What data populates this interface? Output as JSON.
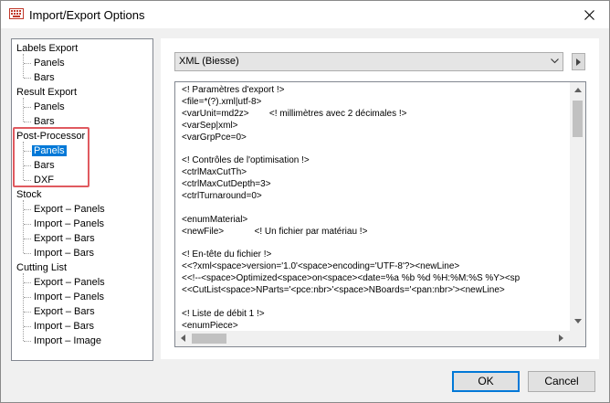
{
  "window": {
    "title": "Import/Export Options"
  },
  "tree": {
    "items": [
      "Labels Export",
      "Panels",
      "Bars",
      "Result Export",
      "Panels",
      "Bars",
      "Post-Processor",
      "Panels",
      "Bars",
      "DXF",
      "Stock",
      "Export – Panels",
      "Import – Panels",
      "Export – Bars",
      "Import – Bars",
      "Cutting List",
      "Export – Panels",
      "Import – Panels",
      "Export – Bars",
      "Import – Bars",
      "Import – Image"
    ],
    "selected": "Post-Processor / Panels"
  },
  "format": {
    "selected": "XML (Biesse)"
  },
  "editor": {
    "lines": [
      "<! Paramètres d'export !>",
      "<file=*(?).xml|utf-8>",
      "<varUnit=md2z>        <! millimètres avec 2 décimales !>",
      "<varSep|xml>",
      "<varGrpPce=0>",
      "",
      "<! Contrôles de l'optimisation !>",
      "<ctrlMaxCutTh>",
      "<ctrlMaxCutDepth=3>",
      "<ctrlTurnaround=0>",
      "",
      "<enumMaterial>",
      "<newFile>            <! Un fichier par matériau !>",
      "",
      "<! En-tête du fichier !>",
      "<<?xml<space>version='1.0'<space>encoding='UTF-8'?><newLine>",
      "<<!--<space>Optimized<space>on<space><date=%a %b %d %H:%M:%S %Y><sp",
      "<<CutList<space>NParts='<pce:nbr>'<space>NBoards='<pan:nbr>'><newLine>",
      "",
      "<! Liste de débit 1 !>",
      "<enumPiece>"
    ]
  },
  "buttons": {
    "ok": "OK",
    "cancel": "Cancel"
  },
  "colors": {
    "selection": "#0078d7",
    "highlight_border": "#e05a60"
  }
}
